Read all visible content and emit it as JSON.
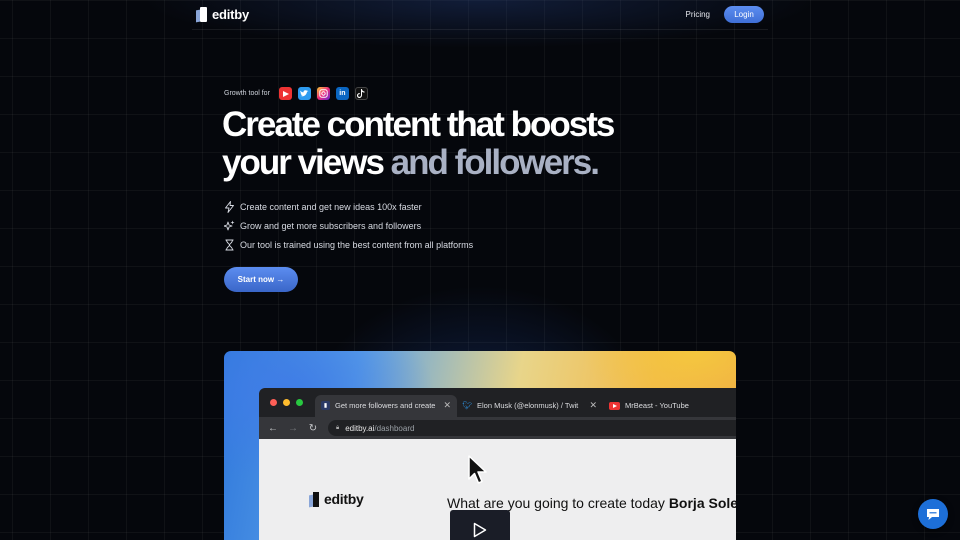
{
  "nav": {
    "logo_text": "editby",
    "pricing_label": "Pricing",
    "login_label": "Login"
  },
  "hero": {
    "growth_label": "Growth tool for",
    "social_icons": [
      "youtube-icon",
      "twitter-icon",
      "instagram-icon",
      "linkedin-icon",
      "tiktok-icon"
    ],
    "headline_line1": "Create content that boosts",
    "headline_line2_a": "your views",
    "headline_line2_b": "and",
    "headline_line2_c": "followers.",
    "features": [
      {
        "icon": "lightning-icon",
        "text": "Create content and get new ideas 100x faster"
      },
      {
        "icon": "sparkles-icon",
        "text": "Grow and get more subscribers and followers"
      },
      {
        "icon": "hourglass-icon",
        "text": "Our tool is trained using the best content from all platforms"
      }
    ],
    "cta_label": "Start now →"
  },
  "screenshot": {
    "tabs": [
      {
        "title": "Get more followers and create",
        "icon": "editby-tab-icon"
      },
      {
        "title": "Elon Musk (@elonmusk) / Twit",
        "icon": "twitter-icon"
      },
      {
        "title": "MrBeast - YouTube",
        "icon": "youtube-icon"
      }
    ],
    "url_host": "editby.ai",
    "url_path": "/dashboard",
    "inner_logo_text": "editby",
    "question_text": "What are you going to create today",
    "question_name": "Borja Sole"
  },
  "colors": {
    "accent": "#4f7fe6",
    "background": "#05070c",
    "muted_text": "#a9b1c4"
  }
}
